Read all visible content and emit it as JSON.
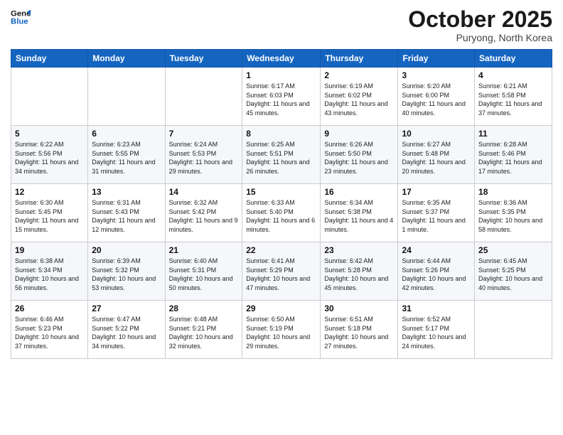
{
  "logo": {
    "line1": "General",
    "line2": "Blue"
  },
  "title": "October 2025",
  "location": "Puryong, North Korea",
  "days_header": [
    "Sunday",
    "Monday",
    "Tuesday",
    "Wednesday",
    "Thursday",
    "Friday",
    "Saturday"
  ],
  "weeks": [
    [
      {
        "day": "",
        "sunrise": "",
        "sunset": "",
        "daylight": ""
      },
      {
        "day": "",
        "sunrise": "",
        "sunset": "",
        "daylight": ""
      },
      {
        "day": "",
        "sunrise": "",
        "sunset": "",
        "daylight": ""
      },
      {
        "day": "1",
        "sunrise": "Sunrise: 6:17 AM",
        "sunset": "Sunset: 6:03 PM",
        "daylight": "Daylight: 11 hours and 45 minutes."
      },
      {
        "day": "2",
        "sunrise": "Sunrise: 6:19 AM",
        "sunset": "Sunset: 6:02 PM",
        "daylight": "Daylight: 11 hours and 43 minutes."
      },
      {
        "day": "3",
        "sunrise": "Sunrise: 6:20 AM",
        "sunset": "Sunset: 6:00 PM",
        "daylight": "Daylight: 11 hours and 40 minutes."
      },
      {
        "day": "4",
        "sunrise": "Sunrise: 6:21 AM",
        "sunset": "Sunset: 5:58 PM",
        "daylight": "Daylight: 11 hours and 37 minutes."
      }
    ],
    [
      {
        "day": "5",
        "sunrise": "Sunrise: 6:22 AM",
        "sunset": "Sunset: 5:56 PM",
        "daylight": "Daylight: 11 hours and 34 minutes."
      },
      {
        "day": "6",
        "sunrise": "Sunrise: 6:23 AM",
        "sunset": "Sunset: 5:55 PM",
        "daylight": "Daylight: 11 hours and 31 minutes."
      },
      {
        "day": "7",
        "sunrise": "Sunrise: 6:24 AM",
        "sunset": "Sunset: 5:53 PM",
        "daylight": "Daylight: 11 hours and 29 minutes."
      },
      {
        "day": "8",
        "sunrise": "Sunrise: 6:25 AM",
        "sunset": "Sunset: 5:51 PM",
        "daylight": "Daylight: 11 hours and 26 minutes."
      },
      {
        "day": "9",
        "sunrise": "Sunrise: 6:26 AM",
        "sunset": "Sunset: 5:50 PM",
        "daylight": "Daylight: 11 hours and 23 minutes."
      },
      {
        "day": "10",
        "sunrise": "Sunrise: 6:27 AM",
        "sunset": "Sunset: 5:48 PM",
        "daylight": "Daylight: 11 hours and 20 minutes."
      },
      {
        "day": "11",
        "sunrise": "Sunrise: 6:28 AM",
        "sunset": "Sunset: 5:46 PM",
        "daylight": "Daylight: 11 hours and 17 minutes."
      }
    ],
    [
      {
        "day": "12",
        "sunrise": "Sunrise: 6:30 AM",
        "sunset": "Sunset: 5:45 PM",
        "daylight": "Daylight: 11 hours and 15 minutes."
      },
      {
        "day": "13",
        "sunrise": "Sunrise: 6:31 AM",
        "sunset": "Sunset: 5:43 PM",
        "daylight": "Daylight: 11 hours and 12 minutes."
      },
      {
        "day": "14",
        "sunrise": "Sunrise: 6:32 AM",
        "sunset": "Sunset: 5:42 PM",
        "daylight": "Daylight: 11 hours and 9 minutes."
      },
      {
        "day": "15",
        "sunrise": "Sunrise: 6:33 AM",
        "sunset": "Sunset: 5:40 PM",
        "daylight": "Daylight: 11 hours and 6 minutes."
      },
      {
        "day": "16",
        "sunrise": "Sunrise: 6:34 AM",
        "sunset": "Sunset: 5:38 PM",
        "daylight": "Daylight: 11 hours and 4 minutes."
      },
      {
        "day": "17",
        "sunrise": "Sunrise: 6:35 AM",
        "sunset": "Sunset: 5:37 PM",
        "daylight": "Daylight: 11 hours and 1 minute."
      },
      {
        "day": "18",
        "sunrise": "Sunrise: 6:36 AM",
        "sunset": "Sunset: 5:35 PM",
        "daylight": "Daylight: 10 hours and 58 minutes."
      }
    ],
    [
      {
        "day": "19",
        "sunrise": "Sunrise: 6:38 AM",
        "sunset": "Sunset: 5:34 PM",
        "daylight": "Daylight: 10 hours and 56 minutes."
      },
      {
        "day": "20",
        "sunrise": "Sunrise: 6:39 AM",
        "sunset": "Sunset: 5:32 PM",
        "daylight": "Daylight: 10 hours and 53 minutes."
      },
      {
        "day": "21",
        "sunrise": "Sunrise: 6:40 AM",
        "sunset": "Sunset: 5:31 PM",
        "daylight": "Daylight: 10 hours and 50 minutes."
      },
      {
        "day": "22",
        "sunrise": "Sunrise: 6:41 AM",
        "sunset": "Sunset: 5:29 PM",
        "daylight": "Daylight: 10 hours and 47 minutes."
      },
      {
        "day": "23",
        "sunrise": "Sunrise: 6:42 AM",
        "sunset": "Sunset: 5:28 PM",
        "daylight": "Daylight: 10 hours and 45 minutes."
      },
      {
        "day": "24",
        "sunrise": "Sunrise: 6:44 AM",
        "sunset": "Sunset: 5:26 PM",
        "daylight": "Daylight: 10 hours and 42 minutes."
      },
      {
        "day": "25",
        "sunrise": "Sunrise: 6:45 AM",
        "sunset": "Sunset: 5:25 PM",
        "daylight": "Daylight: 10 hours and 40 minutes."
      }
    ],
    [
      {
        "day": "26",
        "sunrise": "Sunrise: 6:46 AM",
        "sunset": "Sunset: 5:23 PM",
        "daylight": "Daylight: 10 hours and 37 minutes."
      },
      {
        "day": "27",
        "sunrise": "Sunrise: 6:47 AM",
        "sunset": "Sunset: 5:22 PM",
        "daylight": "Daylight: 10 hours and 34 minutes."
      },
      {
        "day": "28",
        "sunrise": "Sunrise: 6:48 AM",
        "sunset": "Sunset: 5:21 PM",
        "daylight": "Daylight: 10 hours and 32 minutes."
      },
      {
        "day": "29",
        "sunrise": "Sunrise: 6:50 AM",
        "sunset": "Sunset: 5:19 PM",
        "daylight": "Daylight: 10 hours and 29 minutes."
      },
      {
        "day": "30",
        "sunrise": "Sunrise: 6:51 AM",
        "sunset": "Sunset: 5:18 PM",
        "daylight": "Daylight: 10 hours and 27 minutes."
      },
      {
        "day": "31",
        "sunrise": "Sunrise: 6:52 AM",
        "sunset": "Sunset: 5:17 PM",
        "daylight": "Daylight: 10 hours and 24 minutes."
      },
      {
        "day": "",
        "sunrise": "",
        "sunset": "",
        "daylight": ""
      }
    ]
  ]
}
